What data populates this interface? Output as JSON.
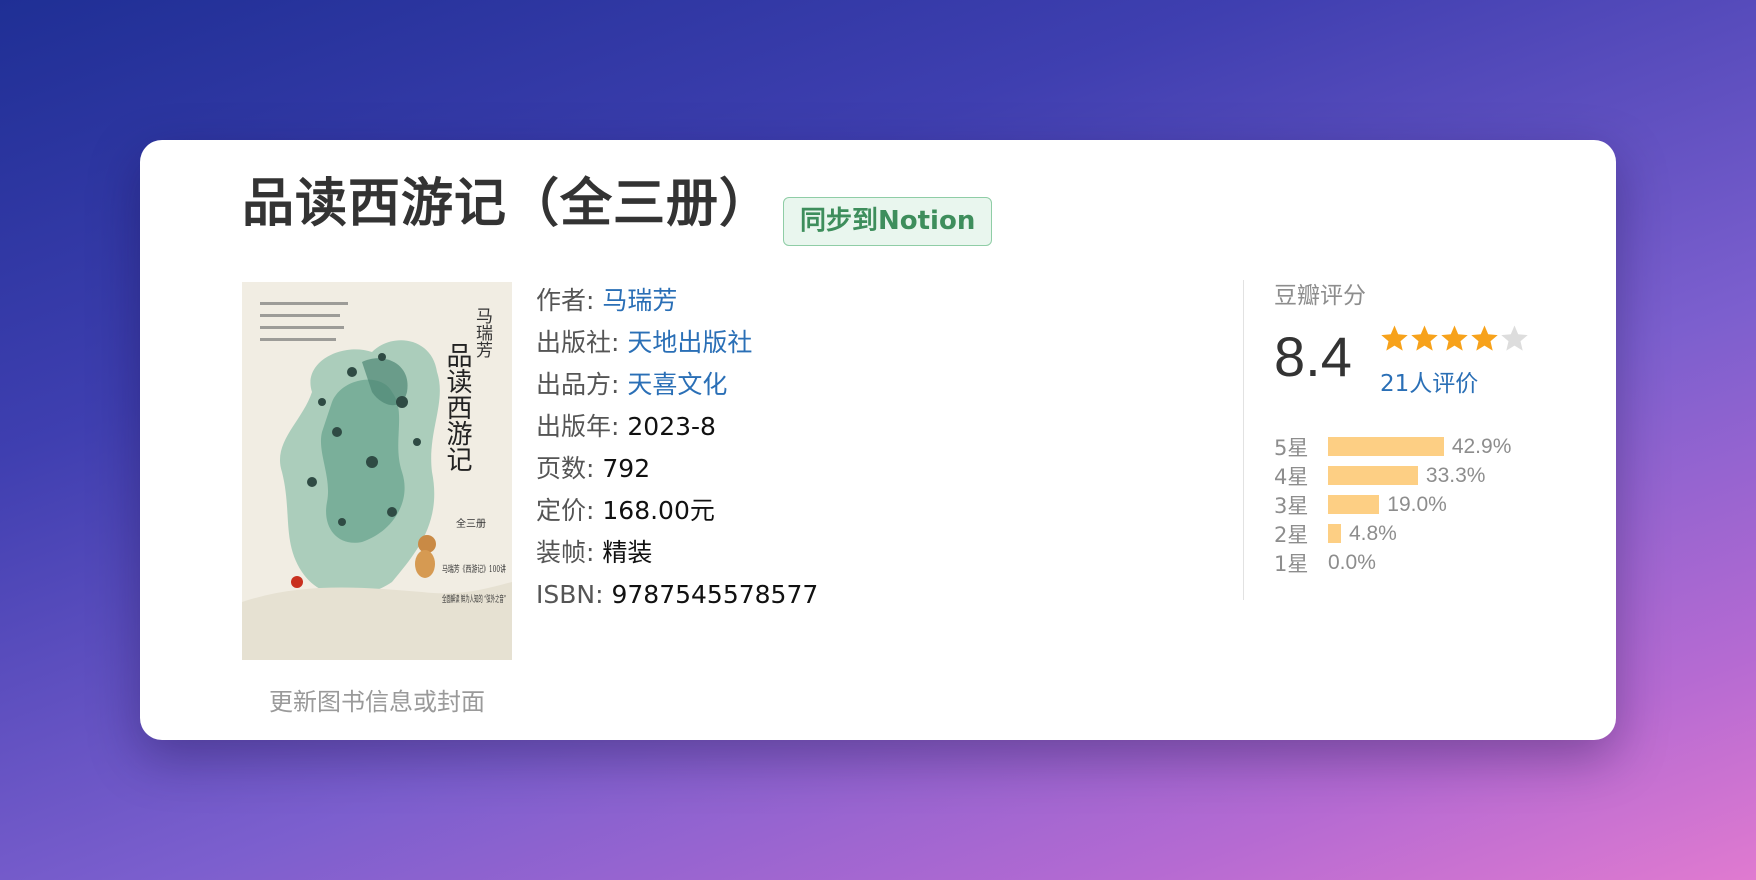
{
  "book": {
    "title": "品读西游记（全三册）",
    "sync_button": "同步到Notion",
    "update_link": "更新图书信息或封面",
    "fields": [
      {
        "label": "作者",
        "value": "马瑞芳",
        "is_link": true
      },
      {
        "label": "出版社",
        "value": "天地出版社",
        "is_link": true
      },
      {
        "label": "出品方",
        "value": "天喜文化",
        "is_link": true
      },
      {
        "label": "出版年",
        "value": "2023-8",
        "is_link": false
      },
      {
        "label": "页数",
        "value": "792",
        "is_link": false
      },
      {
        "label": "定价",
        "value": "168.00元",
        "is_link": false
      },
      {
        "label": "装帧",
        "value": "精装",
        "is_link": false
      },
      {
        "label": "ISBN",
        "value": "9787545578577",
        "is_link": false
      }
    ]
  },
  "cover": {
    "title_vertical": "品读西游记",
    "author_vertical": "马瑞芳",
    "subtitle": "全三册",
    "series": "马瑞芳《西游记》100讲",
    "tagline": "全面解读 鲜为人知的 “弦外之音”"
  },
  "rating": {
    "title": "豆瓣评分",
    "score": "8.4",
    "stars_filled": 4,
    "stars_total": 5,
    "count": "21人评价",
    "distribution": [
      {
        "label": "5星",
        "percent": 42.9,
        "text": "42.9%"
      },
      {
        "label": "4星",
        "percent": 33.3,
        "text": "33.3%"
      },
      {
        "label": "3星",
        "percent": 19.0,
        "text": "19.0%"
      },
      {
        "label": "2星",
        "percent": 4.8,
        "text": "4.8%"
      },
      {
        "label": "1星",
        "percent": 0.0,
        "text": "0.0%"
      }
    ]
  },
  "colors": {
    "link": "#2a6fb6",
    "star_filled": "#f7a21b",
    "star_empty": "#dddddd",
    "bar": "#fdcf84",
    "notion_green": "#3e8e5c"
  }
}
